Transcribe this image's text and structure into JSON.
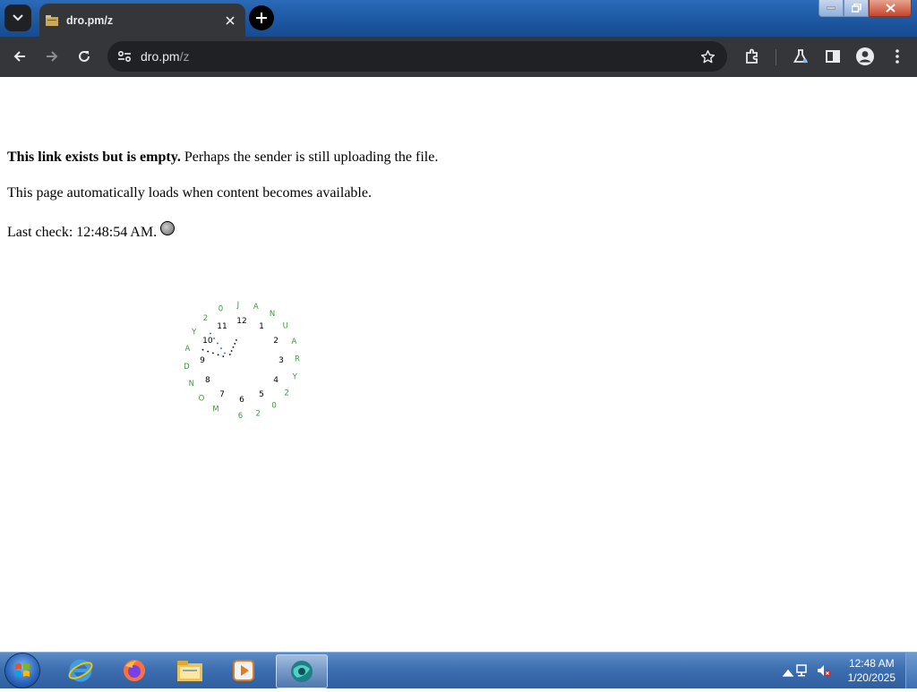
{
  "browser": {
    "tab": {
      "title": "dro.pm/z"
    },
    "url": {
      "host": "dro.pm",
      "path": "/z"
    }
  },
  "page": {
    "message_bold": "This link exists but is empty.",
    "message_rest": " Perhaps the sender is still uploading the file.",
    "auto_load": "This page automatically loads when content becomes available.",
    "last_check_label": "Last check:",
    "last_check_time": "12:48:54 AM.",
    "clock": {
      "hour_numbers": [
        "12",
        "1",
        "2",
        "3",
        "4",
        "5",
        "6",
        "7",
        "8",
        "9",
        "10",
        "11"
      ],
      "date_letters": [
        "M",
        "O",
        "N",
        "D",
        "A",
        "Y",
        "2",
        "0",
        "J",
        "A",
        "N",
        "U",
        "A",
        "R",
        "Y",
        "2",
        "0",
        "2",
        "6"
      ],
      "date_text_color": "#3c9a3c",
      "time_shown": "12:48:54"
    }
  },
  "taskbar": {
    "apps": [
      "internet-explorer",
      "firefox",
      "file-explorer",
      "media-player",
      "chrome-like-browser"
    ],
    "time": "12:48 AM",
    "date": "1/20/2025"
  }
}
